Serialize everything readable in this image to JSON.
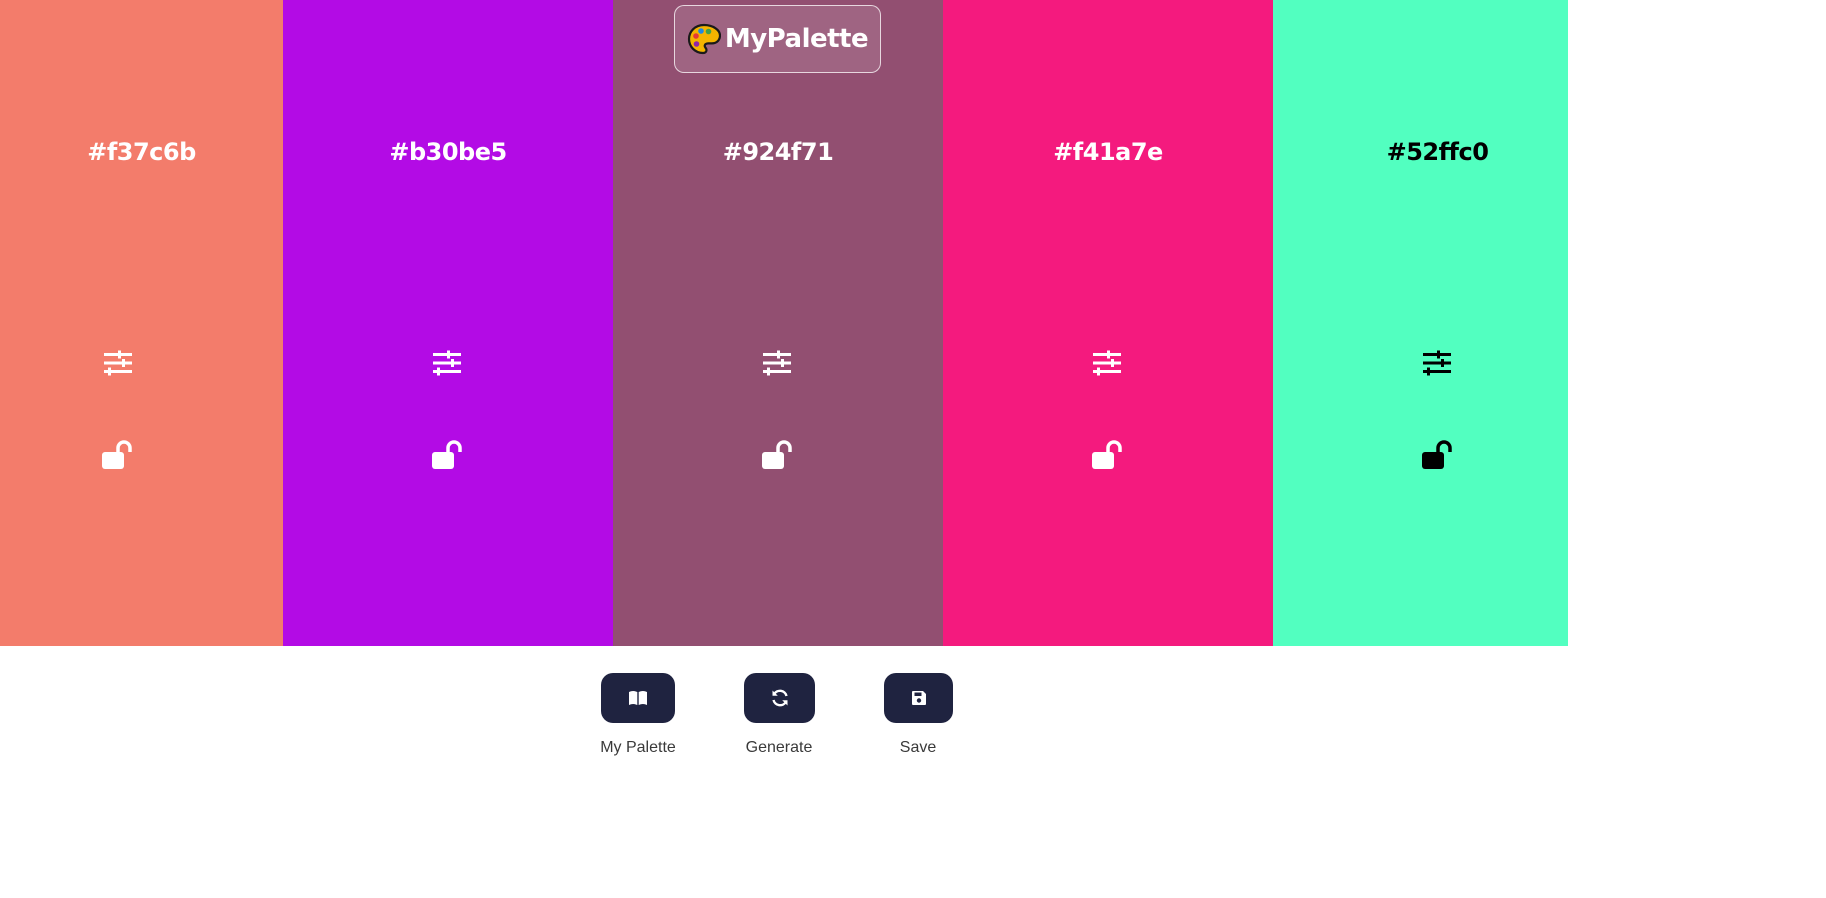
{
  "logo": {
    "text": "MyPalette",
    "icon": "palette-icon"
  },
  "swatches": [
    {
      "hex": "#f37c6b",
      "bg": "#f37c6b",
      "fg": "#ffffff",
      "adjust_icon": "sliders-icon",
      "lock_icon": "unlock-icon"
    },
    {
      "hex": "#b30be5",
      "bg": "#b30be5",
      "fg": "#ffffff",
      "adjust_icon": "sliders-icon",
      "lock_icon": "unlock-icon"
    },
    {
      "hex": "#924f71",
      "bg": "#924f71",
      "fg": "#ffffff",
      "adjust_icon": "sliders-icon",
      "lock_icon": "unlock-icon"
    },
    {
      "hex": "#f41a7e",
      "bg": "#f41a7e",
      "fg": "#ffffff",
      "adjust_icon": "sliders-icon",
      "lock_icon": "unlock-icon"
    },
    {
      "hex": "#52ffc0",
      "bg": "#52ffc0",
      "fg": "#000000",
      "adjust_icon": "sliders-icon",
      "lock_icon": "unlock-icon"
    }
  ],
  "panel": {
    "buttons": [
      {
        "label": "My Palette",
        "icon": "book-icon"
      },
      {
        "label": "Generate",
        "icon": "refresh-icon"
      },
      {
        "label": "Save",
        "icon": "floppy-disk-icon"
      }
    ],
    "button_color": "#1f2340"
  }
}
